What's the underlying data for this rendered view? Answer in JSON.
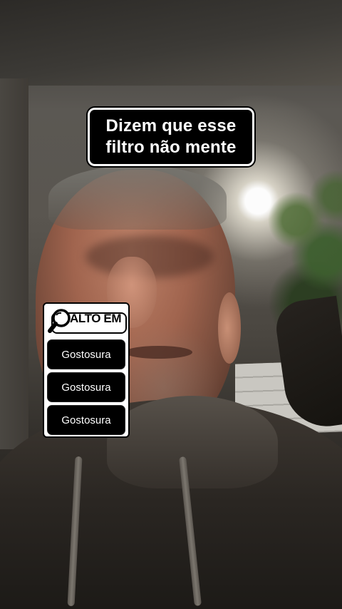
{
  "caption": {
    "line1": "Dizem que esse",
    "line2": "filtro não mente"
  },
  "trending": {
    "header_label": "ALTO EM",
    "icon": "magnifier-icon",
    "items": [
      {
        "label": "Gostosura"
      },
      {
        "label": "Gostosura"
      },
      {
        "label": "Gostosura"
      }
    ]
  },
  "colors": {
    "overlay_background": "#000000",
    "overlay_text": "#ffffff",
    "panel_background": "#ffffff"
  }
}
